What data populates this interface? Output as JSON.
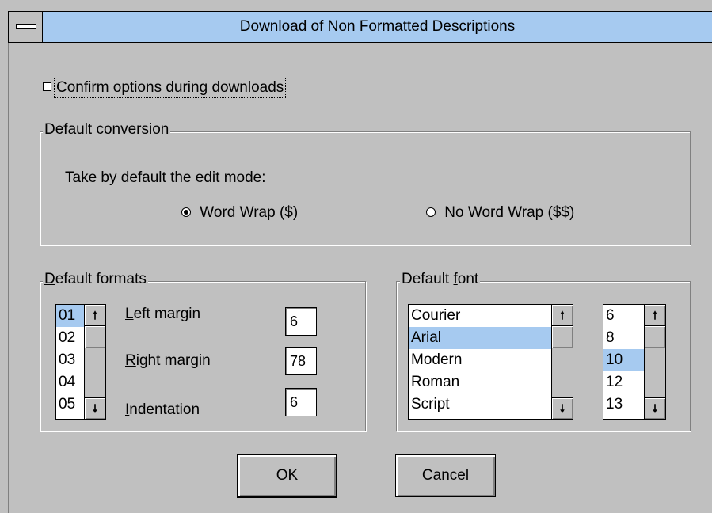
{
  "window": {
    "title": "Download of Non Formatted Descriptions"
  },
  "confirm_option": {
    "label_mnemonic": "C",
    "label_rest": "onfirm options during downloads",
    "checked": false
  },
  "conversion": {
    "group_title": "Default conversion",
    "prompt": "Take by default the edit mode:",
    "word_wrap": {
      "label_pre": "Word Wrap (",
      "mnemonic": "$",
      "label_post": ")",
      "selected": true
    },
    "no_word_wrap": {
      "mnemonic": "N",
      "label_rest": "o Word Wrap ($$)",
      "selected": false
    }
  },
  "formats": {
    "group_title_mnemonic": "D",
    "group_title_rest": "efault formats",
    "list": [
      "01",
      "02",
      "03",
      "04",
      "05"
    ],
    "selected": "01",
    "left_margin": {
      "mnemonic": "L",
      "label_rest": "eft margin",
      "value": "6"
    },
    "right_margin": {
      "mnemonic": "R",
      "label_rest": "ight margin",
      "value": "78"
    },
    "indentation": {
      "mnemonic": "I",
      "label_rest": "ndentation",
      "value": "6"
    }
  },
  "font": {
    "group_title_pre": "Default ",
    "group_title_mnemonic": "f",
    "group_title_post": "ont",
    "faces": [
      "Courier",
      "Arial",
      "Modern",
      "Roman",
      "Script"
    ],
    "selected_face": "Arial",
    "sizes": [
      "6",
      "8",
      "10",
      "12",
      "13"
    ],
    "selected_size": "10"
  },
  "buttons": {
    "ok": "OK",
    "cancel": "Cancel"
  },
  "icons": {
    "system_menu": "system-menu-icon",
    "scroll_up": "scroll-up-arrow-icon",
    "scroll_down": "scroll-down-arrow-icon"
  },
  "colors": {
    "title_bar": "#a6caf0",
    "selection": "#a6caf0",
    "face": "#c0c0c0"
  }
}
